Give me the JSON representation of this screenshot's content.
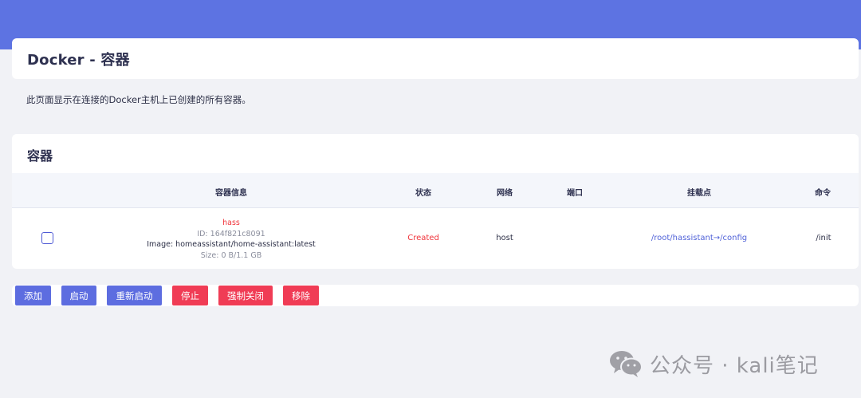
{
  "page": {
    "title": "Docker - 容器",
    "description": "此页面显示在连接的Docker主机上已创建的所有容器。"
  },
  "containers": {
    "section_title": "容器",
    "columns": [
      "容器信息",
      "状态",
      "网络",
      "端口",
      "挂载点",
      "命令"
    ],
    "rows": [
      {
        "name": "hass",
        "id": "ID: 164f821c8091",
        "image": "Image: homeassistant/home-assistant:latest",
        "size": "Size: 0 B/1.1 GB",
        "status": "Created",
        "network": "host",
        "ports": "",
        "mount": "/root/hassistant→/config",
        "command": "/init",
        "checked": false
      }
    ]
  },
  "actions": {
    "add": "添加",
    "start": "启动",
    "restart": "重新启动",
    "stop": "停止",
    "force_stop": "强制关闭",
    "remove": "移除"
  },
  "watermark": {
    "text": "公众号 · kali笔记",
    "icon": "wechat-icon"
  },
  "colors": {
    "top_band": "#5d73e2",
    "primary_button": "#5d6de0",
    "danger_button": "#f03c55",
    "status_created": "#f0333a",
    "mount_link": "#5062d8"
  }
}
